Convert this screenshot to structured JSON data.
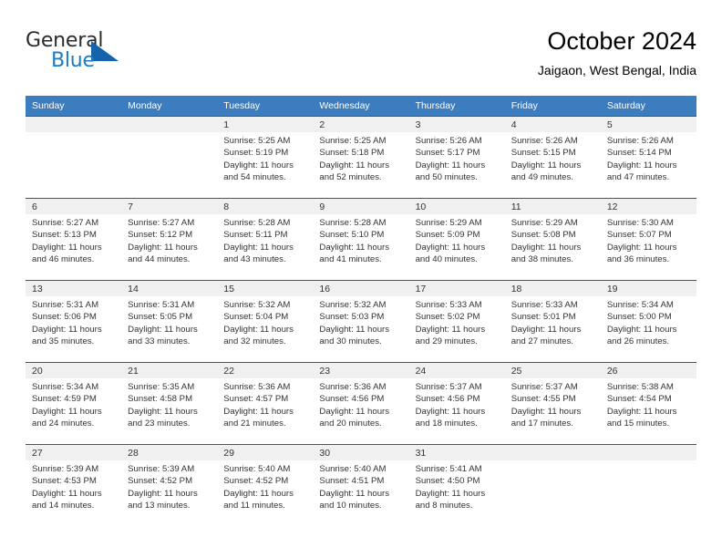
{
  "brand": {
    "name_part1": "General",
    "name_part2": "Blue",
    "logo_icon": "triangle-flag-icon",
    "accent_color": "#1b7bc4",
    "triangle_color": "#1464ab"
  },
  "header": {
    "title": "October 2024",
    "subtitle": "Jaigaon, West Bengal, India"
  },
  "theme": {
    "header_row_bg": "#3c7dc0",
    "header_row_text": "#ffffff",
    "row_divider": "#1f5c99",
    "daynum_band_bg": "#f0f0f0",
    "cell_bg": "#ffffff",
    "text": "#333333"
  },
  "weekday_headers": [
    "Sunday",
    "Monday",
    "Tuesday",
    "Wednesday",
    "Thursday",
    "Friday",
    "Saturday"
  ],
  "weeks": [
    [
      {
        "day": "",
        "sunrise": "",
        "sunset": "",
        "daylight_line1": "",
        "daylight_line2": ""
      },
      {
        "day": "",
        "sunrise": "",
        "sunset": "",
        "daylight_line1": "",
        "daylight_line2": ""
      },
      {
        "day": "1",
        "sunrise": "Sunrise: 5:25 AM",
        "sunset": "Sunset: 5:19 PM",
        "daylight_line1": "Daylight: 11 hours",
        "daylight_line2": "and 54 minutes."
      },
      {
        "day": "2",
        "sunrise": "Sunrise: 5:25 AM",
        "sunset": "Sunset: 5:18 PM",
        "daylight_line1": "Daylight: 11 hours",
        "daylight_line2": "and 52 minutes."
      },
      {
        "day": "3",
        "sunrise": "Sunrise: 5:26 AM",
        "sunset": "Sunset: 5:17 PM",
        "daylight_line1": "Daylight: 11 hours",
        "daylight_line2": "and 50 minutes."
      },
      {
        "day": "4",
        "sunrise": "Sunrise: 5:26 AM",
        "sunset": "Sunset: 5:15 PM",
        "daylight_line1": "Daylight: 11 hours",
        "daylight_line2": "and 49 minutes."
      },
      {
        "day": "5",
        "sunrise": "Sunrise: 5:26 AM",
        "sunset": "Sunset: 5:14 PM",
        "daylight_line1": "Daylight: 11 hours",
        "daylight_line2": "and 47 minutes."
      }
    ],
    [
      {
        "day": "6",
        "sunrise": "Sunrise: 5:27 AM",
        "sunset": "Sunset: 5:13 PM",
        "daylight_line1": "Daylight: 11 hours",
        "daylight_line2": "and 46 minutes."
      },
      {
        "day": "7",
        "sunrise": "Sunrise: 5:27 AM",
        "sunset": "Sunset: 5:12 PM",
        "daylight_line1": "Daylight: 11 hours",
        "daylight_line2": "and 44 minutes."
      },
      {
        "day": "8",
        "sunrise": "Sunrise: 5:28 AM",
        "sunset": "Sunset: 5:11 PM",
        "daylight_line1": "Daylight: 11 hours",
        "daylight_line2": "and 43 minutes."
      },
      {
        "day": "9",
        "sunrise": "Sunrise: 5:28 AM",
        "sunset": "Sunset: 5:10 PM",
        "daylight_line1": "Daylight: 11 hours",
        "daylight_line2": "and 41 minutes."
      },
      {
        "day": "10",
        "sunrise": "Sunrise: 5:29 AM",
        "sunset": "Sunset: 5:09 PM",
        "daylight_line1": "Daylight: 11 hours",
        "daylight_line2": "and 40 minutes."
      },
      {
        "day": "11",
        "sunrise": "Sunrise: 5:29 AM",
        "sunset": "Sunset: 5:08 PM",
        "daylight_line1": "Daylight: 11 hours",
        "daylight_line2": "and 38 minutes."
      },
      {
        "day": "12",
        "sunrise": "Sunrise: 5:30 AM",
        "sunset": "Sunset: 5:07 PM",
        "daylight_line1": "Daylight: 11 hours",
        "daylight_line2": "and 36 minutes."
      }
    ],
    [
      {
        "day": "13",
        "sunrise": "Sunrise: 5:31 AM",
        "sunset": "Sunset: 5:06 PM",
        "daylight_line1": "Daylight: 11 hours",
        "daylight_line2": "and 35 minutes."
      },
      {
        "day": "14",
        "sunrise": "Sunrise: 5:31 AM",
        "sunset": "Sunset: 5:05 PM",
        "daylight_line1": "Daylight: 11 hours",
        "daylight_line2": "and 33 minutes."
      },
      {
        "day": "15",
        "sunrise": "Sunrise: 5:32 AM",
        "sunset": "Sunset: 5:04 PM",
        "daylight_line1": "Daylight: 11 hours",
        "daylight_line2": "and 32 minutes."
      },
      {
        "day": "16",
        "sunrise": "Sunrise: 5:32 AM",
        "sunset": "Sunset: 5:03 PM",
        "daylight_line1": "Daylight: 11 hours",
        "daylight_line2": "and 30 minutes."
      },
      {
        "day": "17",
        "sunrise": "Sunrise: 5:33 AM",
        "sunset": "Sunset: 5:02 PM",
        "daylight_line1": "Daylight: 11 hours",
        "daylight_line2": "and 29 minutes."
      },
      {
        "day": "18",
        "sunrise": "Sunrise: 5:33 AM",
        "sunset": "Sunset: 5:01 PM",
        "daylight_line1": "Daylight: 11 hours",
        "daylight_line2": "and 27 minutes."
      },
      {
        "day": "19",
        "sunrise": "Sunrise: 5:34 AM",
        "sunset": "Sunset: 5:00 PM",
        "daylight_line1": "Daylight: 11 hours",
        "daylight_line2": "and 26 minutes."
      }
    ],
    [
      {
        "day": "20",
        "sunrise": "Sunrise: 5:34 AM",
        "sunset": "Sunset: 4:59 PM",
        "daylight_line1": "Daylight: 11 hours",
        "daylight_line2": "and 24 minutes."
      },
      {
        "day": "21",
        "sunrise": "Sunrise: 5:35 AM",
        "sunset": "Sunset: 4:58 PM",
        "daylight_line1": "Daylight: 11 hours",
        "daylight_line2": "and 23 minutes."
      },
      {
        "day": "22",
        "sunrise": "Sunrise: 5:36 AM",
        "sunset": "Sunset: 4:57 PM",
        "daylight_line1": "Daylight: 11 hours",
        "daylight_line2": "and 21 minutes."
      },
      {
        "day": "23",
        "sunrise": "Sunrise: 5:36 AM",
        "sunset": "Sunset: 4:56 PM",
        "daylight_line1": "Daylight: 11 hours",
        "daylight_line2": "and 20 minutes."
      },
      {
        "day": "24",
        "sunrise": "Sunrise: 5:37 AM",
        "sunset": "Sunset: 4:56 PM",
        "daylight_line1": "Daylight: 11 hours",
        "daylight_line2": "and 18 minutes."
      },
      {
        "day": "25",
        "sunrise": "Sunrise: 5:37 AM",
        "sunset": "Sunset: 4:55 PM",
        "daylight_line1": "Daylight: 11 hours",
        "daylight_line2": "and 17 minutes."
      },
      {
        "day": "26",
        "sunrise": "Sunrise: 5:38 AM",
        "sunset": "Sunset: 4:54 PM",
        "daylight_line1": "Daylight: 11 hours",
        "daylight_line2": "and 15 minutes."
      }
    ],
    [
      {
        "day": "27",
        "sunrise": "Sunrise: 5:39 AM",
        "sunset": "Sunset: 4:53 PM",
        "daylight_line1": "Daylight: 11 hours",
        "daylight_line2": "and 14 minutes."
      },
      {
        "day": "28",
        "sunrise": "Sunrise: 5:39 AM",
        "sunset": "Sunset: 4:52 PM",
        "daylight_line1": "Daylight: 11 hours",
        "daylight_line2": "and 13 minutes."
      },
      {
        "day": "29",
        "sunrise": "Sunrise: 5:40 AM",
        "sunset": "Sunset: 4:52 PM",
        "daylight_line1": "Daylight: 11 hours",
        "daylight_line2": "and 11 minutes."
      },
      {
        "day": "30",
        "sunrise": "Sunrise: 5:40 AM",
        "sunset": "Sunset: 4:51 PM",
        "daylight_line1": "Daylight: 11 hours",
        "daylight_line2": "and 10 minutes."
      },
      {
        "day": "31",
        "sunrise": "Sunrise: 5:41 AM",
        "sunset": "Sunset: 4:50 PM",
        "daylight_line1": "Daylight: 11 hours",
        "daylight_line2": "and 8 minutes."
      },
      {
        "day": "",
        "sunrise": "",
        "sunset": "",
        "daylight_line1": "",
        "daylight_line2": ""
      },
      {
        "day": "",
        "sunrise": "",
        "sunset": "",
        "daylight_line1": "",
        "daylight_line2": ""
      }
    ]
  ]
}
